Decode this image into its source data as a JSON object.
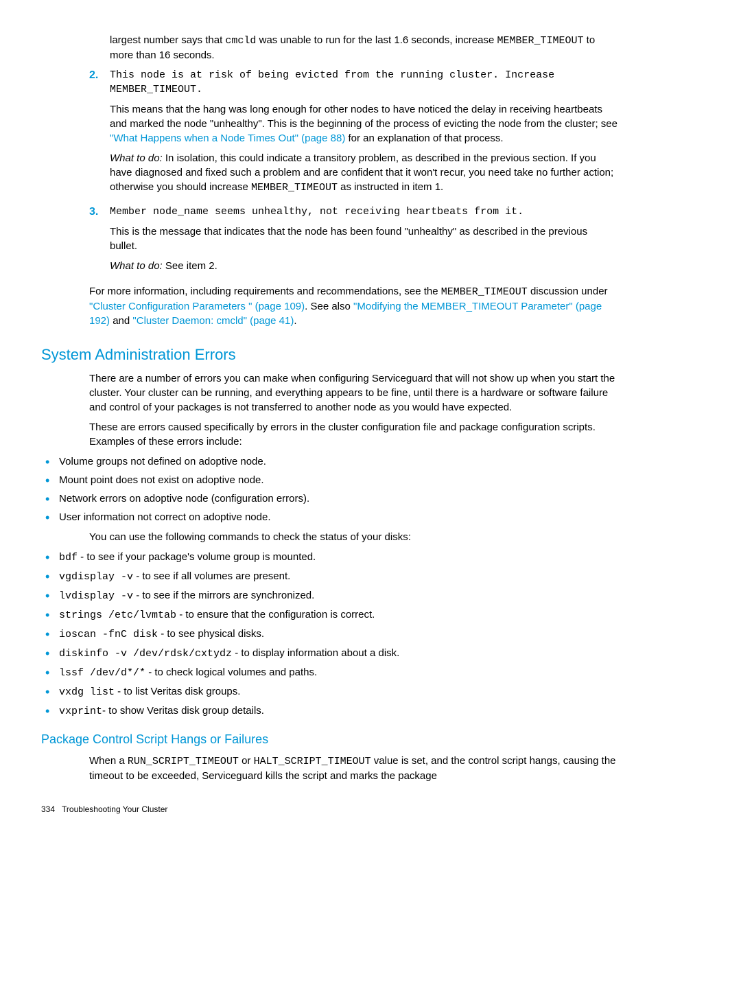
{
  "intro": {
    "p1a": "largest number says that ",
    "p1b": " was unable to run for the last 1.6 seconds, increase ",
    "p1c": " to more than 16 seconds.",
    "code_cmcld": "cmcld",
    "code_member_timeout": "MEMBER_TIMEOUT"
  },
  "item2": {
    "num": "2.",
    "code": "This node is at risk of being evicted from the running cluster. Increase MEMBER_TIMEOUT.",
    "p1a": "This means that the hang was long enough for other nodes to have noticed the delay in receiving heartbeats and marked the node \"unhealthy\". This is the beginning of the process of evicting the node from the cluster; see ",
    "link1": "\"What Happens when a Node Times Out\" (page 88)",
    "p1b": " for an explanation of that process.",
    "wtd_prefix": "What to do:",
    "wtd_body_a": " In isolation, this could indicate a transitory problem, as described in the previous section. If you have diagnosed and fixed such a problem and are confident that it won't recur, you need take no further action; otherwise you should increase ",
    "wtd_code": "MEMBER_TIMEOUT",
    "wtd_body_b": " as instructed in item 1."
  },
  "item3": {
    "num": "3.",
    "code": "Member node_name seems unhealthy, not receiving heartbeats from it.",
    "p1": "This is the message that indicates that the node has been found \"unhealthy\" as described in the previous bullet.",
    "wtd_prefix": "What to do:",
    "wtd_body": " See item 2."
  },
  "more_info": {
    "p_a": "For more information, including requirements and recommendations, see the ",
    "code": "MEMBER_TIMEOUT",
    "p_b": " discussion under ",
    "link1": "\"Cluster Configuration Parameters \" (page 109)",
    "p_c": ". See also ",
    "link2": "\"Modifying the MEMBER_TIMEOUT Parameter\" (page 192)",
    "p_d": " and ",
    "link3": "\"Cluster Daemon: cmcld\" (page 41)",
    "p_e": "."
  },
  "section": {
    "title": "System Administration Errors",
    "p1": "There are a number of errors you can make when configuring Serviceguard that will not show up when you start the cluster. Your cluster can be running, and everything appears to be fine, until there is a hardware or software failure and control of your packages is not transferred to another node as you would have expected.",
    "p2": "These are errors caused specifically by errors in the cluster configuration file and package configuration scripts. Examples of these errors include:",
    "bullets1": [
      "Volume groups not defined on adoptive node.",
      "Mount point does not exist on adoptive node.",
      "Network errors on adoptive node (configuration errors).",
      "User information not correct on adoptive node."
    ],
    "p3": "You can use the following commands to check the status of your disks:",
    "cmds": [
      {
        "code": "bdf",
        "desc": " - to see if your package's volume group is mounted."
      },
      {
        "code": "vgdisplay -v",
        "desc": " - to see if all volumes are present."
      },
      {
        "code": "lvdisplay -v",
        "desc": " - to see if the mirrors are synchronized."
      },
      {
        "code": "strings /etc/lvmtab",
        "desc": " - to ensure that the configuration is correct."
      },
      {
        "code": "ioscan -fnC disk",
        "desc": " - to see physical disks."
      },
      {
        "code": "diskinfo -v /dev/rdsk/cxtydz",
        "desc": " - to display information about a disk."
      },
      {
        "code": "lssf /dev/d*/*",
        "desc": " - to check logical volumes and paths."
      },
      {
        "code": "vxdg list",
        "desc": " - to list Veritas disk groups."
      },
      {
        "code": "vxprint",
        "desc": "- to show Veritas disk group details."
      }
    ]
  },
  "subsection": {
    "title": "Package Control Script Hangs or Failures",
    "p_a": "When a ",
    "code1": "RUN_SCRIPT_TIMEOUT",
    "p_b": " or ",
    "code2": "HALT_SCRIPT_TIMEOUT",
    "p_c": " value is set, and the control script hangs, causing the timeout to be exceeded, Serviceguard kills the script and marks the package"
  },
  "footer": {
    "page": "334",
    "title": "Troubleshooting Your Cluster"
  }
}
